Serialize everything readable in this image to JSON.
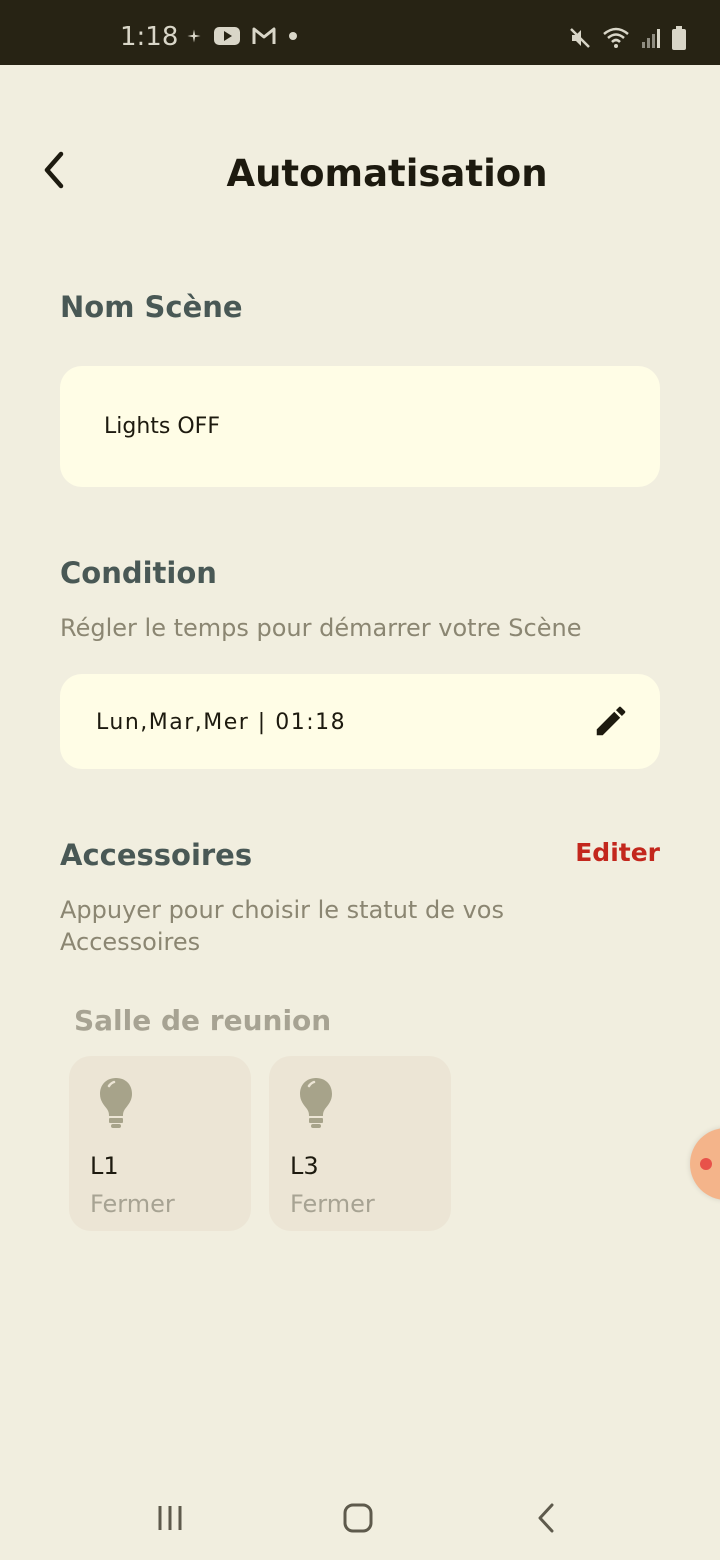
{
  "status_bar": {
    "time": "1:18",
    "left_icons": [
      "sparkle-icon",
      "youtube-icon",
      "gmail-icon",
      "dot-icon"
    ],
    "right_icons": [
      "mute-icon",
      "wifi-icon",
      "signal-icon",
      "battery-icon"
    ]
  },
  "header": {
    "title": "Automatisation",
    "back_icon": "chevron-left-icon"
  },
  "scene_name": {
    "label": "Nom Scène",
    "value": "Lights OFF"
  },
  "condition": {
    "label": "Condition",
    "subtitle": "Régler le temps pour démarrer votre Scène",
    "value": "Lun,Mar,Mer | 01:18",
    "edit_icon": "pencil-icon"
  },
  "accessories": {
    "label": "Accessoires",
    "edit_label": "Editer",
    "subtitle": "Appuyer pour choisir le statut de vos Accessoires",
    "room": "Salle de reunion",
    "items": [
      {
        "name": "L1",
        "status": "Fermer",
        "icon": "lightbulb-icon"
      },
      {
        "name": "L3",
        "status": "Fermer",
        "icon": "lightbulb-icon"
      }
    ]
  },
  "colors": {
    "background": "#f1eedf",
    "card": "#fffde6",
    "tile": "#ece5d5",
    "accent_red": "#c3271d",
    "status_bar": "#272314"
  },
  "nav_bar": {
    "items": [
      "recent-apps-icon",
      "home-icon",
      "back-icon"
    ]
  }
}
